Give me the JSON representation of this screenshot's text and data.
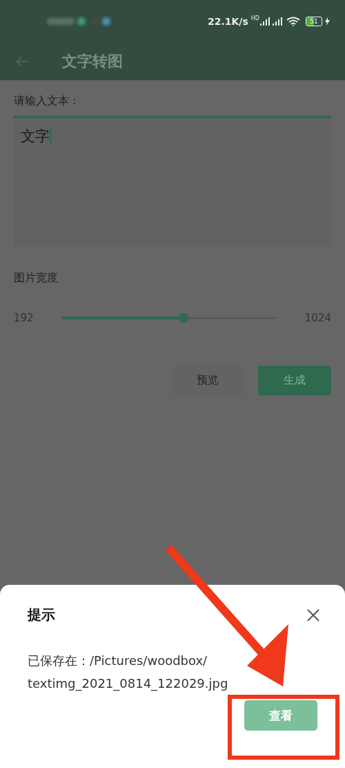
{
  "status_bar": {
    "network_speed": "22.1K/s",
    "hd_label": "HD",
    "battery": "51"
  },
  "app_bar": {
    "title": "文字转图"
  },
  "text_input": {
    "label": "请输入文本：",
    "value": "文字"
  },
  "width_slider": {
    "label": "图片宽度",
    "min_label": "192",
    "max_label": "1024",
    "level": 0.565
  },
  "buttons": [
    {
      "label": "预览",
      "kind": "secondary"
    },
    {
      "label": "生成",
      "kind": "primary"
    }
  ],
  "dialog": {
    "title": "提示",
    "message_lines": [
      "已保存在：/Pictures/woodbox/",
      "textimg_2021_0814_122029.jpg"
    ],
    "button": "查看"
  }
}
